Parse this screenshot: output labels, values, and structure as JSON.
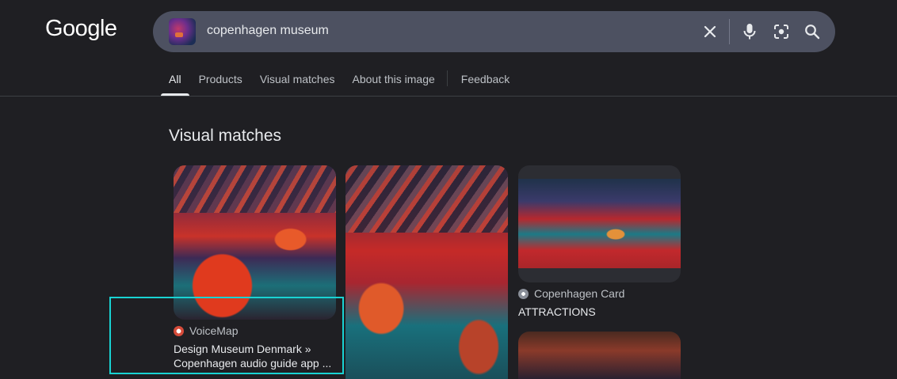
{
  "header": {
    "logo": "Google",
    "search": {
      "query": "copenhagen museum",
      "icons": [
        "close-icon",
        "microphone-icon",
        "lens-icon",
        "search-icon"
      ]
    }
  },
  "tabs": [
    {
      "label": "All",
      "active": true
    },
    {
      "label": "Products",
      "active": false
    },
    {
      "label": "Visual matches",
      "active": false
    },
    {
      "label": "About this image",
      "active": false
    },
    {
      "label": "Feedback",
      "active": false
    }
  ],
  "section": {
    "title": "Visual matches"
  },
  "results": [
    {
      "source": "VoiceMap",
      "title_line1": "Design Museum Denmark »",
      "title_line2": "Copenhagen audio guide app ..."
    },
    {
      "source": "",
      "title_line1": "",
      "title_line2": ""
    },
    {
      "source": "Copenhagen Card",
      "title_line1": "ATTRACTIONS",
      "title_line2": ""
    }
  ],
  "colors": {
    "background": "#1f1f23",
    "searchbox": "#4d5161",
    "highlight": "#19d3d3"
  }
}
